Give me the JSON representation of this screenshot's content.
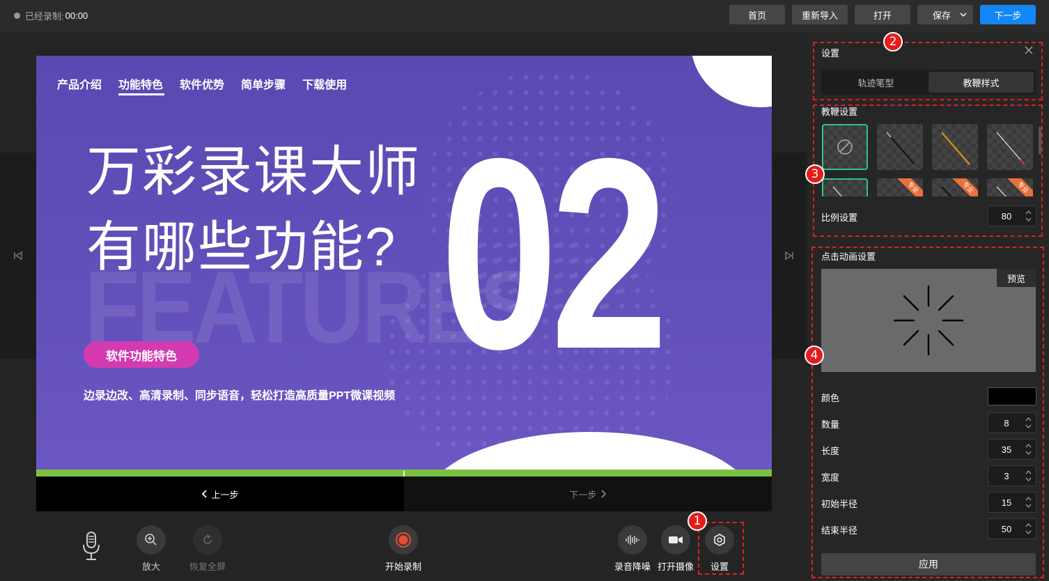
{
  "topbar": {
    "rec_label": "已经录制:",
    "rec_time": "00:00",
    "buttons": {
      "home": "首页",
      "reimport": "重新导入",
      "open": "打开",
      "save": "保存",
      "next": "下一步"
    }
  },
  "slide": {
    "nav": [
      "产品介绍",
      "功能特色",
      "软件优势",
      "简单步骤",
      "下载使用"
    ],
    "active_nav": "功能特色",
    "title_line1": "万彩录课大师",
    "title_line2": "有哪些功能?",
    "bg_word": "FEATURES",
    "number": "02",
    "badge": "软件功能特色",
    "subtitle": "边录边改、高清录制、同步语音，轻松打造高质量PPT微课视频",
    "colors": {
      "background": "#5b4ab5",
      "badge": "#d43bb1",
      "progress": "#7bc242"
    }
  },
  "stepbar": {
    "prev": "上一步",
    "next": "下一步"
  },
  "controls": {
    "zoom": "放大",
    "restore": "恢复全屏",
    "record": "开始录制",
    "denoise": "录音降噪",
    "camera": "打开摄像",
    "settings": "设置"
  },
  "panel": {
    "title": "设置",
    "tabs": {
      "track": "轨迹笔型",
      "pointer": "教鞭样式"
    },
    "pointer_section": "教鞭设置",
    "pro_ribbon": "专业",
    "scale_label": "比例设置",
    "scale_value": "80",
    "anim_section": "点击动画设置",
    "preview": "预览",
    "color_label": "颜色",
    "color_value": "#000000",
    "fields": [
      {
        "label": "数量",
        "value": "8"
      },
      {
        "label": "长度",
        "value": "35"
      },
      {
        "label": "宽度",
        "value": "3"
      },
      {
        "label": "初始半径",
        "value": "15"
      },
      {
        "label": "结束半径",
        "value": "50"
      }
    ],
    "apply": "应用"
  },
  "markers": [
    "1",
    "2",
    "3",
    "4"
  ]
}
